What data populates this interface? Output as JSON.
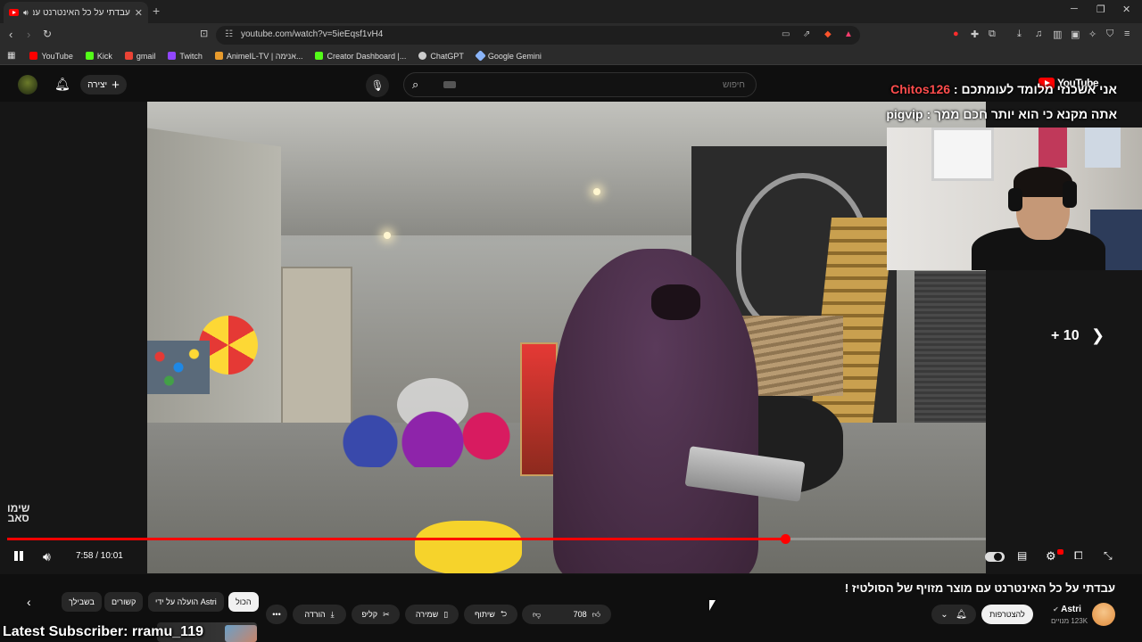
{
  "browser": {
    "tab_title": "עבדתי על כל האינטרנט עם מ",
    "url": "youtube.com/watch?v=5ieEqsf1vH4",
    "bookmarks": [
      {
        "label": "YouTube",
        "color": "#ff0000"
      },
      {
        "label": "Kick",
        "color": "#53fc18"
      },
      {
        "label": "gmail",
        "color": "#ea4335"
      },
      {
        "label": "Twitch",
        "color": "#9146ff"
      },
      {
        "label": "AnimeIL-TV | אנימה...",
        "color": "#e89b2c"
      },
      {
        "label": "Creator Dashboard |...",
        "color": "#53fc18"
      },
      {
        "label": "ChatGPT",
        "color": "#cccccc"
      },
      {
        "label": "Google Gemini",
        "color": "#8ab4f8"
      }
    ]
  },
  "masthead": {
    "create_label": "יצירה",
    "search_placeholder": "חיפוש",
    "logo_text": "YouTube"
  },
  "stream_chat": [
    {
      "user": "Chitos126",
      "user_color": "#ff4d4d",
      "message": "אני אשכנזי מלומד לעומתכם"
    },
    {
      "user": "pigvip",
      "user_color": "#ffffff",
      "message": "אתה מקנא כי הוא יותר חכם ממך"
    }
  ],
  "player": {
    "current_time": "7:58",
    "duration": "10:01",
    "time_display": "7:58 / 10:01",
    "progress_fraction": 0.795,
    "next_count": "+ 10",
    "watermark_line1": "שימו",
    "watermark_line2": "סאב"
  },
  "video": {
    "title": "עבדתי על כל האינטרנט עם מוצר מזויף של הסולטיז !",
    "channel_name": "Astri",
    "subscribers": "123K מנויים",
    "subscribe_label": "להצטרפות",
    "like_count": "708",
    "share_label": "שיתוף",
    "save_label": "שמירה",
    "clip_label": "קליפ",
    "download_label": "הורדה"
  },
  "chips": [
    {
      "label": "הכול",
      "active": true
    },
    {
      "label": "הועלה על ידי Astri",
      "active": false
    },
    {
      "label": "קשורים",
      "active": false
    },
    {
      "label": "בשבילך",
      "active": false
    }
  ],
  "overlay": {
    "latest_subscriber": "Latest Subscriber: rramu_119"
  },
  "colors": {
    "accent_red": "#ff0000",
    "background": "#0f0f0f"
  }
}
